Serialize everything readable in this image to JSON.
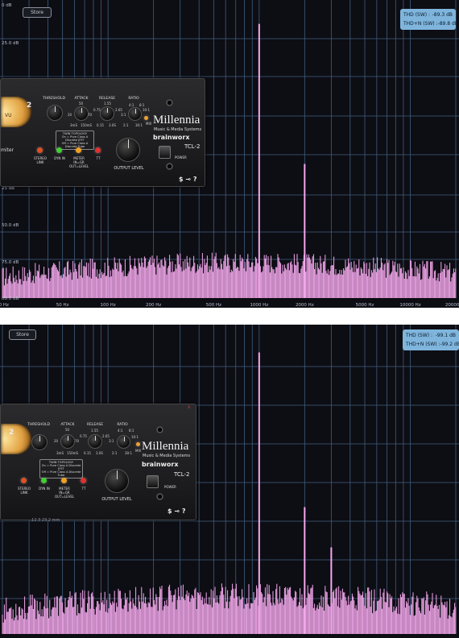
{
  "colors": {
    "grid": "#3f5f7e",
    "spectrum": "#f4a8ec",
    "background": "#0d0d14",
    "thd_box": "#7fb5dc"
  },
  "top": {
    "store_label": "Store",
    "thd": {
      "label": "THD (SW) :",
      "value": "-89.3 dB"
    },
    "thdn": {
      "label": "THD+N (SW) :",
      "value": "-89.8 dB"
    },
    "db_labels": [
      "0 dB",
      "25.0 dB",
      "50.0 dB",
      "75.0 dB",
      "100.0 dB"
    ],
    "db_labels_visible": [
      "0 dB",
      "25.0 dB",
      "25 dB",
      "50.0 dB",
      "75.0 dB",
      "00.0 dB"
    ],
    "freq_labels": [
      "20 Hz",
      "50 Hz",
      "100 Hz",
      "200 Hz",
      "500 Hz",
      "1000 Hz",
      "2000 Hz",
      "5000 Hz",
      "10000 Hz",
      "20000 Hz"
    ],
    "spikes": [
      {
        "freq": 1000,
        "level": 0.08
      },
      {
        "freq": 2000,
        "level": 0.55
      }
    ]
  },
  "bottom": {
    "store_label": "Store",
    "thd": {
      "label": "THD (SW) :",
      "value": "-99.1 dB"
    },
    "thdn": {
      "label": "THD+N (SW) :",
      "value": "-99.2 dB"
    },
    "freq_labels": [
      "20 Hz",
      "50 Hz",
      "100 Hz",
      "200 Hz",
      "500 Hz",
      "1000 Hz",
      "2000 Hz",
      "5000 Hz",
      "10000 Hz",
      "20000 Hz"
    ],
    "spikes": [
      {
        "freq": 1000,
        "level": 0.09
      },
      {
        "freq": 2000,
        "level": 0.59
      },
      {
        "freq": 3000,
        "level": 0.72
      }
    ]
  },
  "plugin": {
    "mode_number": "2",
    "vu_label": "VU",
    "limiter_text": "miter",
    "threshold_label": "THRESHOLD",
    "attack_label": "ATTACK",
    "release_label": "RELEASE",
    "ratio_label": "RATIO",
    "attack_vals": [
      "50",
      "20",
      "70",
      "3mS",
      "150mS"
    ],
    "release_vals": [
      "1.55",
      "0.75",
      "2.65",
      "0.15",
      "3.0S"
    ],
    "ratio_vals": [
      "4:1",
      "8:1",
      "3:1",
      "10:1",
      "2:1",
      "30:1"
    ],
    "twin_title": "TWIN TOPOLOGY",
    "twin_line1": "On = Pure Class A Discrete JFET",
    "twin_line2": "Off = Pure Class A Discrete Tube",
    "stereo_link": "STEREO LINK",
    "dyn_in": "DYN IN",
    "meter": "METER",
    "meter_sub": "IN=GR",
    "meter_sub2": "OUT=LEVEL",
    "tt": "TT",
    "output_level": "OUTPUT LEVEL",
    "brand": "Millennia",
    "brand_sub": "Music & Media Systems",
    "bx_brand": "brainworx",
    "model": "TCL-2",
    "power": "POWER",
    "foot_icons": "$ ⊸ ?",
    "mix": "MIX",
    "close": "x",
    "overlay_text": "..12.3 23.2 mm"
  }
}
